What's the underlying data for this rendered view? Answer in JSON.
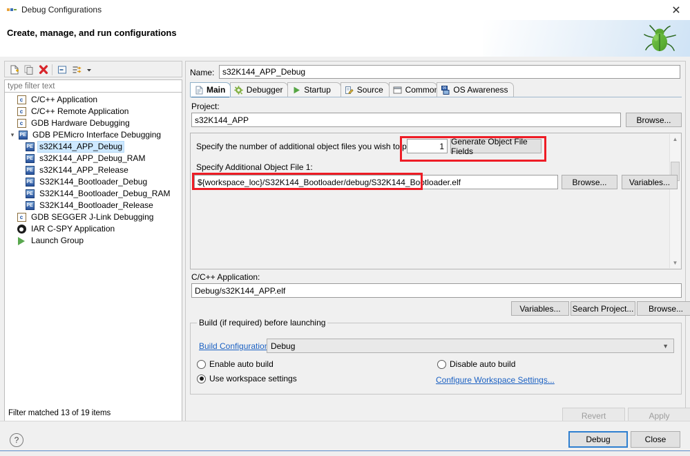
{
  "window": {
    "title": "Debug Configurations",
    "icon": "debug-configurations-icon",
    "close_label": "✕",
    "header_title": "Create, manage, and run configurations",
    "decor_icon": "green-bug-icon"
  },
  "toolbar": {
    "items": [
      {
        "name": "new-configuration-icon",
        "glyph": "📄"
      },
      {
        "name": "duplicate-configuration-icon",
        "glyph": "⧉"
      },
      {
        "name": "delete-configuration-icon",
        "glyph": "✖"
      },
      {
        "name": "collapse-all-icon",
        "glyph": "▭"
      },
      {
        "name": "filter-icon",
        "glyph": "⇥"
      },
      {
        "name": "view-menu-chevron-icon",
        "glyph": "▾"
      }
    ]
  },
  "tree": {
    "filter_placeholder": "type filter text",
    "filter_value": "",
    "status": "Filter matched 13 of 19 items",
    "items": [
      {
        "label": "C/C++ Application",
        "icon": "c-launch-icon",
        "indent": 1,
        "arrow": "",
        "selected": false
      },
      {
        "label": "C/C++ Remote Application",
        "icon": "c-launch-icon",
        "indent": 1,
        "arrow": "",
        "selected": false
      },
      {
        "label": "GDB Hardware Debugging",
        "icon": "c-launch-icon",
        "indent": 1,
        "arrow": "",
        "selected": false
      },
      {
        "label": "GDB PEMicro Interface Debugging",
        "icon": "pemicro-icon",
        "indent": 0,
        "arrow": "expanded",
        "selected": false
      },
      {
        "label": "s32K144_APP_Debug",
        "icon": "pemicro-icon",
        "indent": 2,
        "arrow": "",
        "selected": true
      },
      {
        "label": "s32K144_APP_Debug_RAM",
        "icon": "pemicro-icon",
        "indent": 2,
        "arrow": "",
        "selected": false
      },
      {
        "label": "s32K144_APP_Release",
        "icon": "pemicro-icon",
        "indent": 2,
        "arrow": "",
        "selected": false
      },
      {
        "label": "S32K144_Bootloader_Debug",
        "icon": "pemicro-icon",
        "indent": 2,
        "arrow": "",
        "selected": false
      },
      {
        "label": "S32K144_Bootloader_Debug_RAM",
        "icon": "pemicro-icon",
        "indent": 2,
        "arrow": "",
        "selected": false
      },
      {
        "label": "S32K144_Bootloader_Release",
        "icon": "pemicro-icon",
        "indent": 2,
        "arrow": "",
        "selected": false
      },
      {
        "label": "GDB SEGGER J-Link Debugging",
        "icon": "c-launch-icon",
        "indent": 1,
        "arrow": "",
        "selected": false
      },
      {
        "label": "IAR C-SPY Application",
        "icon": "iar-icon",
        "indent": 1,
        "arrow": "",
        "selected": false
      },
      {
        "label": "Launch Group",
        "icon": "launch-group-icon",
        "indent": 1,
        "arrow": "",
        "selected": false
      }
    ]
  },
  "config": {
    "name_label": "Name:",
    "name_value": "s32K144_APP_Debug",
    "tabs": [
      {
        "label": "Main",
        "icon": "document-icon",
        "active": true
      },
      {
        "label": "Debugger",
        "icon": "gear-icon",
        "active": false
      },
      {
        "label": "Startup",
        "icon": "play-icon",
        "active": false
      },
      {
        "label": "Source",
        "icon": "source-edit-icon",
        "active": false
      },
      {
        "label": "Common",
        "icon": "window-icon",
        "active": false
      },
      {
        "label": "OS Awareness",
        "icon": "os-awareness-icon",
        "active": false
      }
    ],
    "project_label": "Project:",
    "project_value": "s32K144_APP",
    "project_browse_label": "Browse...",
    "object_count_label": "Specify the number of additional object files you wish to program",
    "object_count_value": "1",
    "generate_button_label": "Generate Object File Fields",
    "object_file_label": "Specify Additional Object File 1:",
    "object_file_value": "${workspace_loc}/S32K144_Bootloader/debug/S32K144_Bootloader.elf",
    "object_browse_label": "Browse...",
    "object_variables_label": "Variables...",
    "app_label": "C/C++ Application:",
    "app_value": "Debug/s32K144_APP.elf",
    "app_variables_label": "Variables...",
    "app_search_label": "Search Project...",
    "app_browse_label": "Browse...",
    "build_group_title": "Build (if required) before launching",
    "build_config_link": "Build Configuration:",
    "build_config_value": "Debug",
    "radio_enable_auto_build": "Enable auto build",
    "radio_disable_auto_build": "Disable auto build",
    "radio_use_workspace_settings": "Use workspace settings",
    "configure_workspace_link": "Configure Workspace Settings...",
    "revert_label": "Revert",
    "apply_label": "Apply"
  },
  "footer": {
    "help_label": "?",
    "debug_label": "Debug",
    "close_label": "Close"
  },
  "colors": {
    "highlight_red": "#ee1c25",
    "selection_blue": "#cde8ff",
    "link_blue": "#1a60c2",
    "primary_border": "#2e7fd0"
  }
}
